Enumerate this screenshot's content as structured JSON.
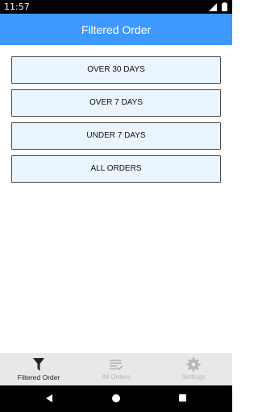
{
  "status_bar": {
    "time": "11:57"
  },
  "app_bar": {
    "title": "Filtered Order"
  },
  "filters": [
    {
      "label": "OVER 30 DAYS"
    },
    {
      "label": "OVER 7 DAYS"
    },
    {
      "label": "UNDER 7 DAYS"
    },
    {
      "label": "ALL ORDERS"
    }
  ],
  "bottom_nav": {
    "items": [
      {
        "label": "Filtered Order",
        "icon": "filter-icon",
        "active": true
      },
      {
        "label": "All Orders",
        "icon": "list-check-icon",
        "active": false
      },
      {
        "label": "Settings",
        "icon": "gear-icon",
        "active": false
      }
    ]
  },
  "colors": {
    "app_bar": "#3d98ff",
    "button_bg": "#eaf5fe",
    "nav_bg": "#e8e8e8",
    "inactive": "#b5b5b5"
  }
}
